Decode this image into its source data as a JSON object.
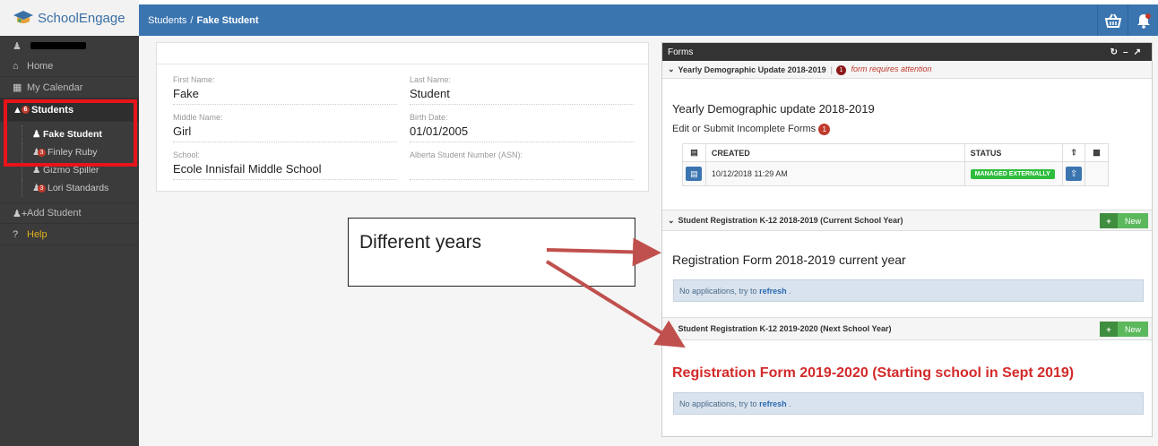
{
  "app": {
    "logo_text": "SchoolEngage"
  },
  "breadcrumb": {
    "parent": "Students",
    "separator": "/",
    "current": "Fake Student"
  },
  "sidebar": {
    "home": "Home",
    "calendar": "My Calendar",
    "students": "Students",
    "students_badge": "6",
    "children": [
      {
        "label": "Fake Student",
        "badge": ""
      },
      {
        "label": "Finley Ruby",
        "badge": "3"
      },
      {
        "label": "Gizmo Spiller",
        "badge": ""
      },
      {
        "label": "Lori Standards",
        "badge": "3"
      }
    ],
    "add_student": "Add Student",
    "help": "Help"
  },
  "student": {
    "first_name_label": "First Name:",
    "first_name": "Fake",
    "last_name_label": "Last Name:",
    "last_name": "Student",
    "middle_name_label": "Middle Name:",
    "middle_name": "Girl",
    "birth_date_label": "Birth Date:",
    "birth_date": "01/01/2005",
    "school_label": "School:",
    "school": "Ecole Innisfail Middle School",
    "asn_label": "Alberta Student Number (ASN):",
    "asn": ""
  },
  "forms": {
    "title": "Forms",
    "sections": [
      {
        "header": "Yearly Demographic Update 2018-2019",
        "separator": "|",
        "attention_count": "1",
        "attention_text": "form requires attention",
        "title": "Yearly Demographic update  2018-2019",
        "incomplete_label": "Edit or Submit Incomplete Forms",
        "incomplete_count": "1",
        "table": {
          "headers": [
            "CREATED",
            "STATUS"
          ],
          "rows": [
            {
              "created": "10/12/2018 11:29 AM",
              "status": "MANAGED EXTERNALLY"
            }
          ]
        }
      },
      {
        "header": "Student Registration K-12 2018-2019 (Current School Year)",
        "new_label": "New",
        "title": "Registration Form 2018-2019 current year",
        "no_apps": "No applications, try to",
        "refresh": "refresh",
        "period": "."
      },
      {
        "header": "Student Registration K-12 2019-2020 (Next School Year)",
        "new_label": "New",
        "title": "Registration Form 2019-2020 (Starting school in Sept 2019)",
        "no_apps": "No applications, try to",
        "refresh": "refresh",
        "period": "."
      }
    ]
  },
  "annotation": {
    "callout": "Different years"
  },
  "colors": {
    "brand_blue": "#3a75b0",
    "sidebar": "#3b3b3b",
    "highlight_red": "#e8141b",
    "status_green": "#2ebd3d",
    "new_green": "#5cb85c"
  }
}
